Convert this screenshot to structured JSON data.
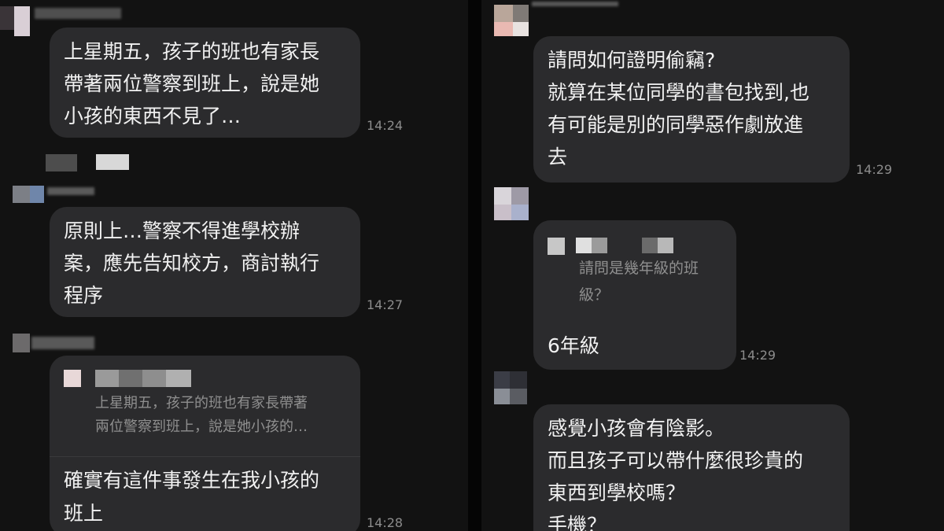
{
  "left_panel": {
    "messages": [
      {
        "lines": [
          "上星期五，孩子的班也有家長",
          "帶著兩位警察到班上，說是她",
          "小孩的東西不見了…"
        ],
        "time": "14:24"
      },
      {
        "lines": [
          "原則上…警察不得進學校辦",
          "案，應先告知校方，商討執行",
          "程序"
        ],
        "time": "14:27"
      },
      {
        "quote": [
          "上星期五，孩子的班也有家長帶著",
          "兩位警察到班上，說是她小孩的…"
        ],
        "lines": [
          "確實有這件事發生在我小孩的",
          "班上"
        ],
        "time": "14:28"
      }
    ]
  },
  "right_panel": {
    "messages": [
      {
        "lines": [
          "請問如何證明偷竊?",
          "就算在某位同學的書包找到,也",
          "有可能是別的同學惡作劇放進",
          "去"
        ],
        "time": "14:29"
      },
      {
        "quote": [
          "請問是幾年級的班",
          "級？"
        ],
        "lines": [
          "6年級"
        ],
        "time": "14:29"
      },
      {
        "lines": [
          "感覺小孩會有陰影。",
          "而且孩子可以帶什麼很珍貴的",
          "東西到學校嗎？",
          "手機？"
        ]
      }
    ]
  }
}
